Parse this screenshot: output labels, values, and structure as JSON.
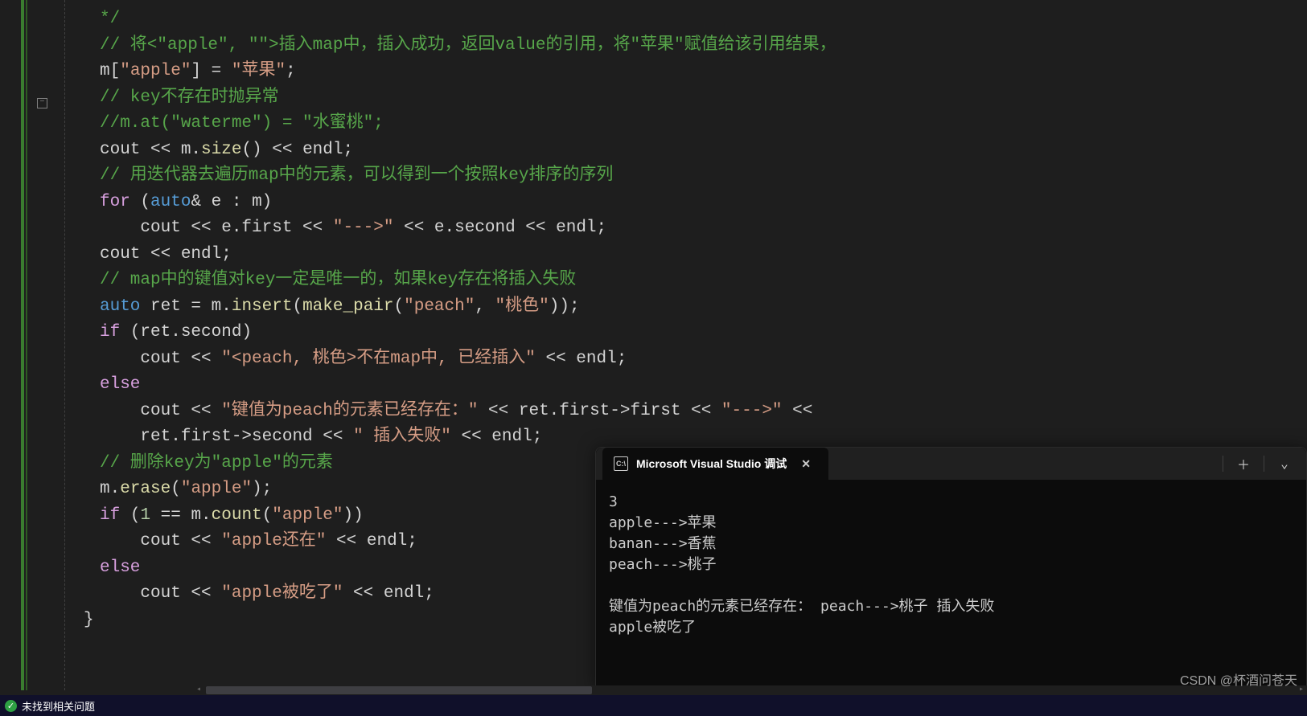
{
  "code": {
    "l1": "*/",
    "l2": "// 将<\"apple\", \"\">插入map中，插入成功，返回value的引用，将\"苹果\"赋值给该引用结果，",
    "l3a": "m[",
    "l3b": "\"apple\"",
    "l3c": "] = ",
    "l3d": "\"苹果\"",
    "l3e": ";",
    "l4": "// key不存在时抛异常",
    "l5": "//m.at(\"waterme\") = \"水蜜桃\";",
    "l6a": "cout << m.",
    "l6b": "size",
    "l6c": "() << endl;",
    "l7": "// 用迭代器去遍历map中的元素，可以得到一个按照key排序的序列",
    "l8a": "for",
    "l8b": " (",
    "l8c": "auto",
    "l8d": "& e : m)",
    "l9a": "    cout << e.first << ",
    "l9b": "\"--->\"",
    "l9c": " << e.second << endl;",
    "l10": "cout << endl;",
    "l11": "// map中的键值对key一定是唯一的，如果key存在将插入失败",
    "l12a": "auto",
    "l12b": " ret = m.",
    "l12c": "insert",
    "l12d": "(",
    "l12e": "make_pair",
    "l12f": "(",
    "l12g": "\"peach\"",
    "l12h": ", ",
    "l12i": "\"桃色\"",
    "l12j": "));",
    "l13a": "if",
    "l13b": " (ret.second)",
    "l14a": "    cout << ",
    "l14b": "\"<peach, 桃色>不在map中, 已经插入\"",
    "l14c": " << endl;",
    "l15": "else",
    "l16a": "    cout << ",
    "l16b": "\"键值为peach的元素已经存在：\"",
    "l16c": " << ret.first->first << ",
    "l16d": "\"--->\"",
    "l16e": " <<",
    "l17a": "    ret.first->second << ",
    "l17b": "\" 插入失败\"",
    "l17c": " << endl;",
    "l18": "// 删除key为\"apple\"的元素",
    "l19a": "m.",
    "l19b": "erase",
    "l19c": "(",
    "l19d": "\"apple\"",
    "l19e": ");",
    "l20a": "if",
    "l20b": " (",
    "l20c": "1",
    "l20d": " == m.",
    "l20e": "count",
    "l20f": "(",
    "l20g": "\"apple\"",
    "l20h": "))",
    "l21a": "    cout << ",
    "l21b": "\"apple还在\"",
    "l21c": " << endl;",
    "l22": "else",
    "l23a": "    cout << ",
    "l23b": "\"apple被吃了\"",
    "l23c": " << endl;",
    "l24": "}"
  },
  "terminal": {
    "tab_title": "Microsoft Visual Studio 调试",
    "icon_glyph": "C:\\",
    "output": "3\napple--->苹果\nbanan--->香蕉\npeach--->桃子\n\n键值为peach的元素已经存在： peach--->桃子 插入失败\napple被吃了"
  },
  "status": {
    "text": "未找到相关问题",
    "check_glyph": "✓"
  },
  "watermark": "CSDN @杯酒问苍天",
  "fold_glyph": "−",
  "chevron_glyph": "⌄",
  "plus_glyph": "＋",
  "close_glyph": "✕",
  "larrow": "◂",
  "rarrow": "▸"
}
